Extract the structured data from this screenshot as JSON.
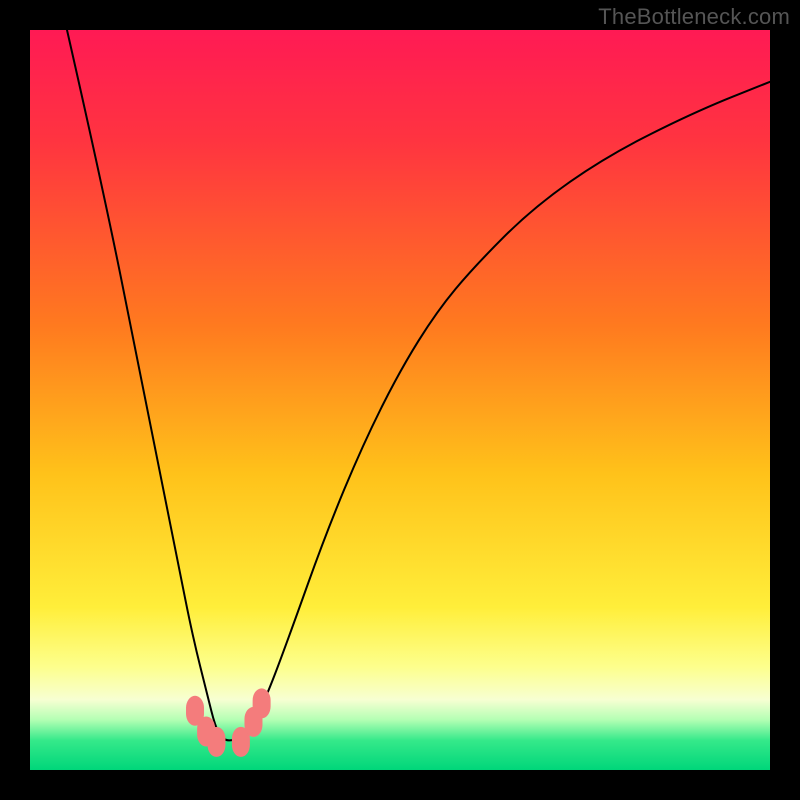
{
  "watermark": "TheBottleneck.com",
  "chart_data": {
    "type": "line",
    "title": "",
    "xlabel": "",
    "ylabel": "",
    "xlim": [
      0,
      100
    ],
    "ylim": [
      0,
      100
    ],
    "gradient_stops": [
      {
        "offset": 0,
        "color": "#ff1a54"
      },
      {
        "offset": 0.15,
        "color": "#ff3440"
      },
      {
        "offset": 0.4,
        "color": "#ff7a1f"
      },
      {
        "offset": 0.6,
        "color": "#ffc21a"
      },
      {
        "offset": 0.78,
        "color": "#ffee3a"
      },
      {
        "offset": 0.86,
        "color": "#fdff8c"
      },
      {
        "offset": 0.905,
        "color": "#f7ffd2"
      },
      {
        "offset": 0.932,
        "color": "#b4ffb4"
      },
      {
        "offset": 0.96,
        "color": "#35e98a"
      },
      {
        "offset": 1.0,
        "color": "#00d67a"
      }
    ],
    "series": [
      {
        "name": "bottleneck-curve",
        "type": "line",
        "stroke": "#000000",
        "stroke_width": 2,
        "x": [
          5,
          10,
          15,
          18,
          20,
          22,
          24,
          25,
          26,
          28,
          30,
          32,
          35,
          40,
          45,
          50,
          55,
          60,
          68,
          78,
          90,
          100
        ],
        "y": [
          100,
          78,
          53,
          38,
          28,
          18,
          10,
          6,
          4,
          4,
          6,
          10,
          18,
          32,
          44,
          54,
          62,
          68,
          76,
          83,
          89,
          93
        ]
      }
    ],
    "markers": [
      {
        "x": 22.3,
        "y": 8.0,
        "color": "#f47c7c"
      },
      {
        "x": 23.8,
        "y": 5.2,
        "color": "#f47c7c"
      },
      {
        "x": 25.2,
        "y": 3.8,
        "color": "#f47c7c"
      },
      {
        "x": 28.5,
        "y": 3.8,
        "color": "#f47c7c"
      },
      {
        "x": 30.2,
        "y": 6.5,
        "color": "#f47c7c"
      },
      {
        "x": 31.3,
        "y": 9.0,
        "color": "#f47c7c"
      }
    ],
    "background_note": "Vertical rainbow gradient from magenta-red (top) through orange, yellow to green (bottom). Black V-shaped curve with salmon dots near the minimum."
  }
}
